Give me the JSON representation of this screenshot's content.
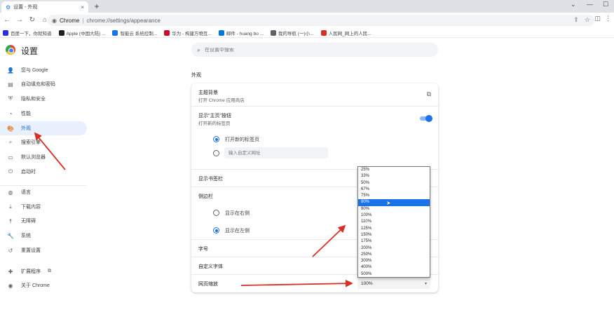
{
  "browser": {
    "tab_title": "设置 - 外观",
    "tab_close": "×",
    "new_tab": "+",
    "window_controls": [
      "⌄",
      "—",
      "☐"
    ],
    "nav": {
      "back": "←",
      "forward": "→",
      "reload": "↻",
      "home": "⌂"
    },
    "site_name": "Chrome",
    "separator": "|",
    "url": "chrome://settings/appearance",
    "address_icons": [
      "⇪",
      "☆"
    ],
    "toolbar_icons": [
      "◫",
      "⋮"
    ]
  },
  "bookmarks": [
    {
      "label": "百度一下，你就知道",
      "color": "#2932e1"
    },
    {
      "label": "Apple (中国大陆) ...",
      "color": "#202124"
    },
    {
      "label": "智能云 系统控制...",
      "color": "#1a73e8"
    },
    {
      "label": "华为 - 构建万物互...",
      "color": "#cf0a2c"
    },
    {
      "label": "邮件 - huang bo ...",
      "color": "#0078d4"
    },
    {
      "label": "我的导航 (一)小...",
      "color": "#5f6368"
    },
    {
      "label": "人民网_网上的人民...",
      "color": "#d93025"
    }
  ],
  "colors": {
    "accent": "#1a73e8",
    "active_bg": "#e8f0fe",
    "arrow": "#d93025"
  },
  "settings": {
    "title": "设置",
    "search_placeholder": "在设置中搜索",
    "search_icon": "⌕"
  },
  "sidebar": {
    "items": [
      {
        "name": "sidebar-item-you-and-google",
        "icon": "person-icon",
        "glyph": "👤",
        "label": "您与 Google"
      },
      {
        "name": "sidebar-item-autofill",
        "icon": "autofill-icon",
        "glyph": "▤",
        "label": "自动填充和密码"
      },
      {
        "name": "sidebar-item-privacy",
        "icon": "shield-icon",
        "glyph": "⛨",
        "label": "隐私和安全"
      },
      {
        "name": "sidebar-item-performance",
        "icon": "speedometer-icon",
        "glyph": "◔",
        "label": "性能"
      },
      {
        "name": "sidebar-item-appearance",
        "icon": "palette-icon",
        "glyph": "🎨",
        "label": "外观",
        "active": true
      },
      {
        "name": "sidebar-item-search-engine",
        "icon": "search-icon",
        "glyph": "⌕",
        "label": "搜索引擎"
      },
      {
        "name": "sidebar-item-default-browser",
        "icon": "browser-icon",
        "glyph": "▭",
        "label": "默认浏览器"
      },
      {
        "name": "sidebar-item-on-startup",
        "icon": "power-icon",
        "glyph": "⏻",
        "label": "启动时"
      },
      {
        "name": "sidebar-item-languages",
        "icon": "globe-icon",
        "glyph": "◍",
        "label": "语言"
      },
      {
        "name": "sidebar-item-downloads",
        "icon": "download-icon",
        "glyph": "⤓",
        "label": "下载内容"
      },
      {
        "name": "sidebar-item-accessibility",
        "icon": "accessibility-icon",
        "glyph": "☨",
        "label": "无障碍"
      },
      {
        "name": "sidebar-item-system",
        "icon": "wrench-icon",
        "glyph": "🔧",
        "label": "系统"
      },
      {
        "name": "sidebar-item-reset",
        "icon": "reset-icon",
        "glyph": "↺",
        "label": "重置设置"
      },
      {
        "name": "sidebar-item-extensions",
        "icon": "puzzle-icon",
        "glyph": "✚",
        "label": "扩展程序",
        "external": "⧉"
      },
      {
        "name": "sidebar-item-about",
        "icon": "chrome-icon",
        "glyph": "◉",
        "label": "关于 Chrome"
      }
    ]
  },
  "appearance": {
    "section_title": "外观",
    "theme_label": "主题背景",
    "theme_sub": "打开 Chrome 应用商店",
    "theme_link_icon": "⧉",
    "home_button_label": "显示\"主页\"按钮",
    "home_button_sub": "打开新的标签页",
    "home_button_on": true,
    "home_option_newtab": "打开新的标签页",
    "home_option_custom_placeholder": "输入自定义网址",
    "bookmarks_bar_label": "显示书签栏",
    "side_panel_label": "侧边栏",
    "side_panel_right": "显示在右侧",
    "side_panel_left": "显示在左侧",
    "font_size_label": "字号",
    "custom_fonts_label": "自定义字体",
    "page_zoom_label": "网页缩放",
    "page_zoom_value": "100%",
    "select_caret": "▾"
  },
  "zoom_options": [
    "25%",
    "33%",
    "50%",
    "67%",
    "75%",
    "80%",
    "90%",
    "100%",
    "110%",
    "125%",
    "150%",
    "175%",
    "200%",
    "250%",
    "300%",
    "400%",
    "500%"
  ],
  "zoom_highlighted": "80%",
  "mouse_cursor": "➤"
}
